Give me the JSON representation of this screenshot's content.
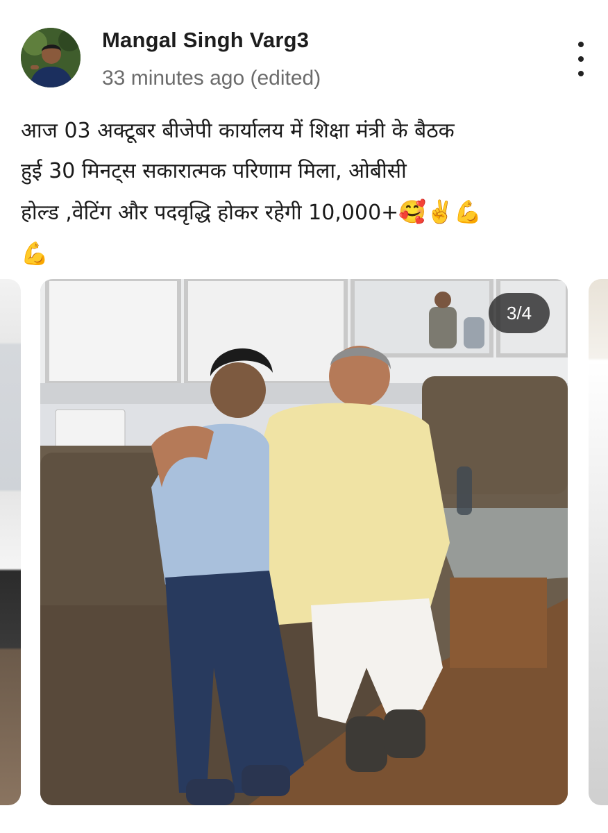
{
  "post": {
    "author_name": "Mangal Singh Varg3",
    "timestamp": "33 minutes ago (edited)",
    "text": "आज 03 अक्टूबर बीजेपी कार्यालय में शिक्षा मंत्री के बैठक\nहुई 30 मिनट्स सकारात्मक परिणाम मिला, ओबीसी\nहोल्ड ,वेटिंग और पदवृद्धि होकर रहेगी 10,000+",
    "emojis_inline": "🥰✌️💪",
    "emojis_last_line": "💪",
    "more_icon": "more-vertical-icon"
  },
  "carousel": {
    "counter_label": "3/4",
    "current": 3,
    "total": 4
  },
  "colors": {
    "background": "#ffffff",
    "author_text": "#1d1d1d",
    "meta_text": "#6b6b6b",
    "counter_bg": "#232323"
  }
}
